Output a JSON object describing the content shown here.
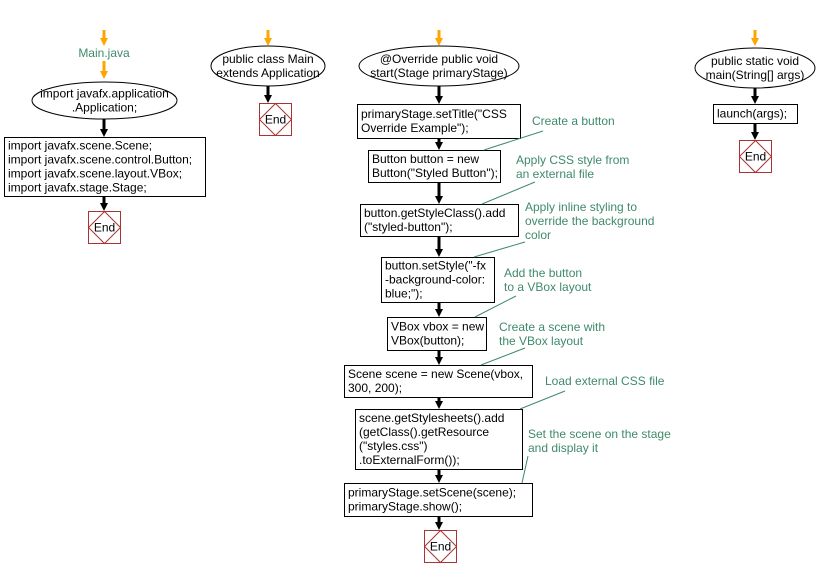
{
  "colors": {
    "start_arrow": "#ffa500",
    "comment": "#3f8a6b",
    "end_border": "#aa3333",
    "edge": "#000000"
  },
  "flows": [
    {
      "label": "Main.java",
      "nodes": [
        {
          "shape": "ellipse",
          "lines": [
            "import javafx.application",
            ".Application;"
          ]
        },
        {
          "shape": "rect",
          "lines": [
            "import javafx.scene.Scene;",
            "import javafx.scene.control.Button;",
            "import javafx.scene.layout.VBox;",
            "import javafx.stage.Stage;"
          ]
        },
        {
          "shape": "end",
          "lines": [
            "End"
          ]
        }
      ]
    },
    {
      "nodes": [
        {
          "shape": "ellipse",
          "lines": [
            "public class Main",
            "extends Application"
          ]
        },
        {
          "shape": "end",
          "lines": [
            "End"
          ]
        }
      ]
    },
    {
      "nodes": [
        {
          "shape": "ellipse",
          "lines": [
            "@Override public void",
            "start(Stage primaryStage)"
          ]
        },
        {
          "shape": "rect",
          "lines": [
            "primaryStage.setTitle(\"CSS",
            "Override Example\");"
          ]
        },
        {
          "shape": "rect",
          "lines": [
            "Button button = new",
            "Button(\"Styled Button\");"
          ]
        },
        {
          "shape": "rect",
          "lines": [
            "button.getStyleClass().add",
            "(\"styled-button\");"
          ]
        },
        {
          "shape": "rect",
          "lines": [
            "button.setStyle(\"-fx",
            "-background-color:",
            "blue;\");"
          ]
        },
        {
          "shape": "rect",
          "lines": [
            "VBox vbox = new",
            "VBox(button);"
          ]
        },
        {
          "shape": "rect",
          "lines": [
            "Scene scene = new Scene(vbox,",
            "300, 200);"
          ]
        },
        {
          "shape": "rect",
          "lines": [
            "scene.getStylesheets().add",
            "(getClass().getResource",
            "(\"styles.css\")",
            ".toExternalForm());"
          ]
        },
        {
          "shape": "rect",
          "lines": [
            "primaryStage.setScene(scene);",
            "primaryStage.show();"
          ]
        },
        {
          "shape": "end",
          "lines": [
            "End"
          ]
        }
      ],
      "comments": [
        {
          "lines": [
            "Create a button"
          ]
        },
        {
          "lines": [
            "Apply CSS style from",
            "an external file"
          ]
        },
        {
          "lines": [
            "Apply inline styling to",
            "override the background",
            "color"
          ]
        },
        {
          "lines": [
            "Add the button",
            "to a VBox layout"
          ]
        },
        {
          "lines": [
            "Create a scene with",
            "the VBox layout"
          ]
        },
        {
          "lines": [
            "Load external CSS file"
          ]
        },
        {
          "lines": [
            "Set the scene on the stage",
            "and display it"
          ]
        }
      ]
    },
    {
      "nodes": [
        {
          "shape": "ellipse",
          "lines": [
            "public static void",
            "main(String[] args)"
          ]
        },
        {
          "shape": "rect",
          "lines": [
            "launch(args);"
          ]
        },
        {
          "shape": "end",
          "lines": [
            "End"
          ]
        }
      ]
    }
  ]
}
